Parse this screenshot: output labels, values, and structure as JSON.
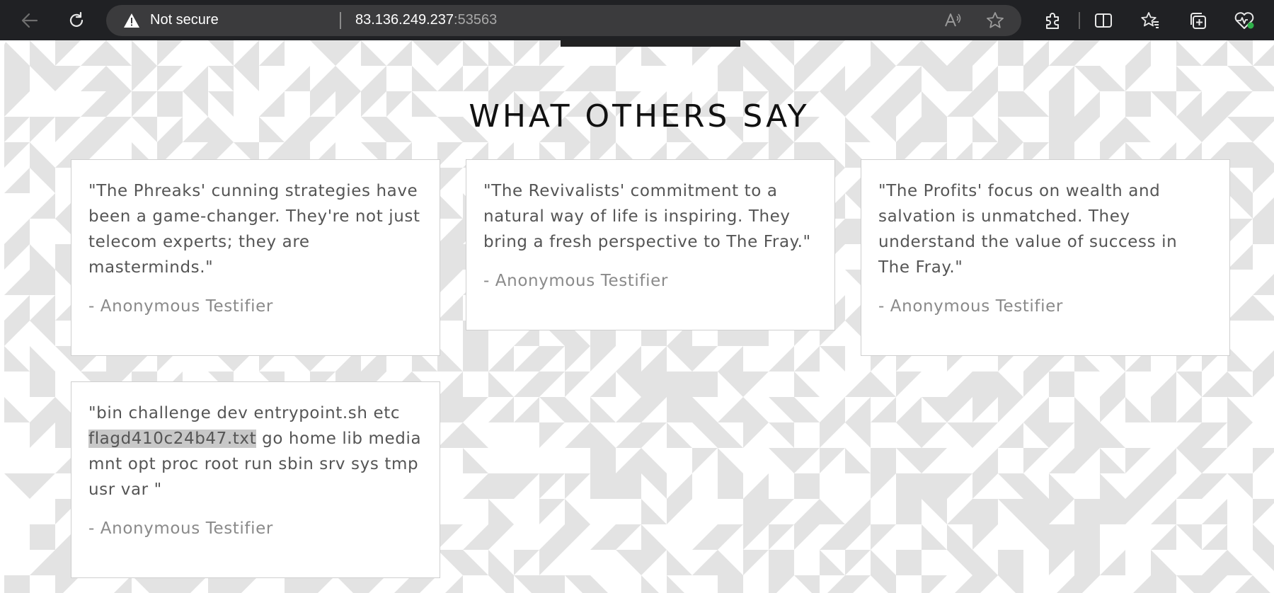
{
  "browser": {
    "security_label": "Not secure",
    "url_host": "83.136.249.237",
    "url_port": ":53563",
    "icons": [
      "back-arrow-icon",
      "refresh-icon",
      "warning-icon",
      "read-aloud-icon",
      "favorite-star-icon",
      "extensions-icon",
      "split-screen-icon",
      "favorites-icon",
      "collections-icon",
      "browser-essentials-icon"
    ]
  },
  "page": {
    "heading": "WHAT OTHERS SAY",
    "testimonials": [
      {
        "quote": "\"The Phreaks' cunning strategies have been a game-changer. They're not just telecom experts; they are masterminds.\"",
        "author": "- Anonymous Testifier"
      },
      {
        "quote": "\"The Revivalists' commitment to a natural way of life is inspiring. They bring a fresh perspective to The Fray.\"",
        "author": "- Anonymous Testifier"
      },
      {
        "quote": "\"The Profits' focus on wealth and salvation is unmatched. They understand the value of success in The Fray.\"",
        "author": "- Anonymous Testifier"
      },
      {
        "quote_before": "\"bin challenge dev entrypoint.sh etc ",
        "quote_highlight": "flagd410c24b47.txt",
        "quote_after": " go home lib media mnt opt proc root run sbin srv sys tmp usr var \"",
        "author": "- Anonymous Testifier"
      }
    ]
  },
  "colors": {
    "chrome": "#202124",
    "addressbar": "#3b3b3d",
    "pattern": "#e3e3e3",
    "selection": "#c8c8c8"
  }
}
